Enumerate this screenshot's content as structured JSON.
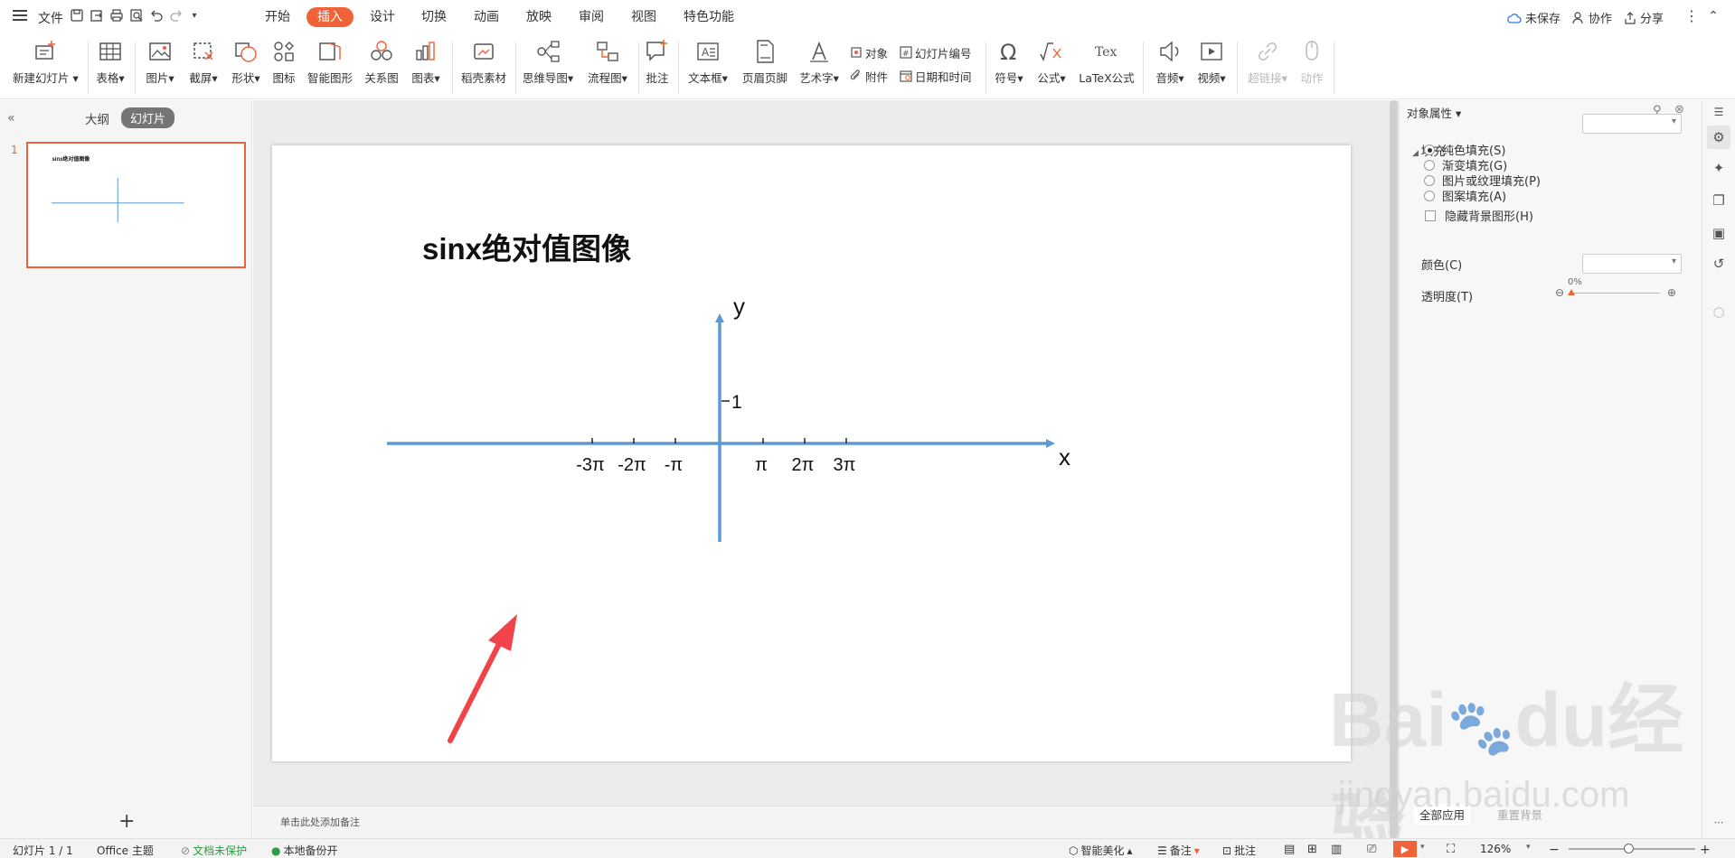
{
  "menu": {
    "file": "文件",
    "tabs": [
      "开始",
      "插入",
      "设计",
      "切换",
      "动画",
      "放映",
      "审阅",
      "视图",
      "特色功能"
    ],
    "active_tab": "插入",
    "unsaved": "未保存",
    "collab": "协作",
    "share": "分享"
  },
  "ribbon": {
    "new_slide": "新建幻灯片",
    "table": "表格",
    "picture": "图片",
    "screenshot": "截屏",
    "shape": "形状",
    "icon": "图标",
    "smart_graphic": "智能图形",
    "relation": "关系图",
    "chart": "图表",
    "material": "稻壳素材",
    "mindmap": "思维导图",
    "flowchart": "流程图",
    "comment": "批注",
    "textbox": "文本框",
    "header_footer": "页眉页脚",
    "wordart": "艺术字",
    "object": "对象",
    "attachment": "附件",
    "slide_number": "幻灯片编号",
    "datetime": "日期和时间",
    "symbol": "符号",
    "formula": "公式",
    "latex": "LaTeX公式",
    "audio": "音频",
    "video": "视频",
    "hyperlink": "超链接",
    "action": "动作"
  },
  "left_panel": {
    "outline_tab": "大纲",
    "slides_tab": "幻灯片",
    "slide_number": "1"
  },
  "slide": {
    "title": "sinx绝对值图像",
    "y_label": "y",
    "x_label": "x",
    "y_tick": "1",
    "x_ticks": [
      "-3π",
      "-2π",
      "-π",
      "π",
      "2π",
      "3π"
    ],
    "axis_color": "#5b9bd5",
    "arrow_color": "#f0444a"
  },
  "notes": {
    "placeholder": "单击此处添加备注"
  },
  "panel": {
    "title": "对象属性",
    "fill_section": "填充",
    "fill_options": [
      "纯色填充(S)",
      "渐变填充(G)",
      "图片或纹理填充(P)",
      "图案填充(A)"
    ],
    "selected_fill": "纯色填充(S)",
    "hide_bg": "隐藏背景图形(H)",
    "color_label": "颜色(C)",
    "transparency_label": "透明度(T)",
    "transparency_value": "0%",
    "apply_all": "全部应用",
    "reset_bg": "重置背景"
  },
  "status": {
    "slide_count": "幻灯片 1 / 1",
    "theme": "Office 主题",
    "protect": "文档未保护",
    "backup": "本地备份开",
    "beautify": "智能美化",
    "notes": "备注",
    "comment": "批注",
    "zoom": "126%"
  },
  "watermark": {
    "brand": "Bai",
    "brand2": "du",
    "jingyan": "经验",
    "url": "jingyan.baidu.com"
  }
}
